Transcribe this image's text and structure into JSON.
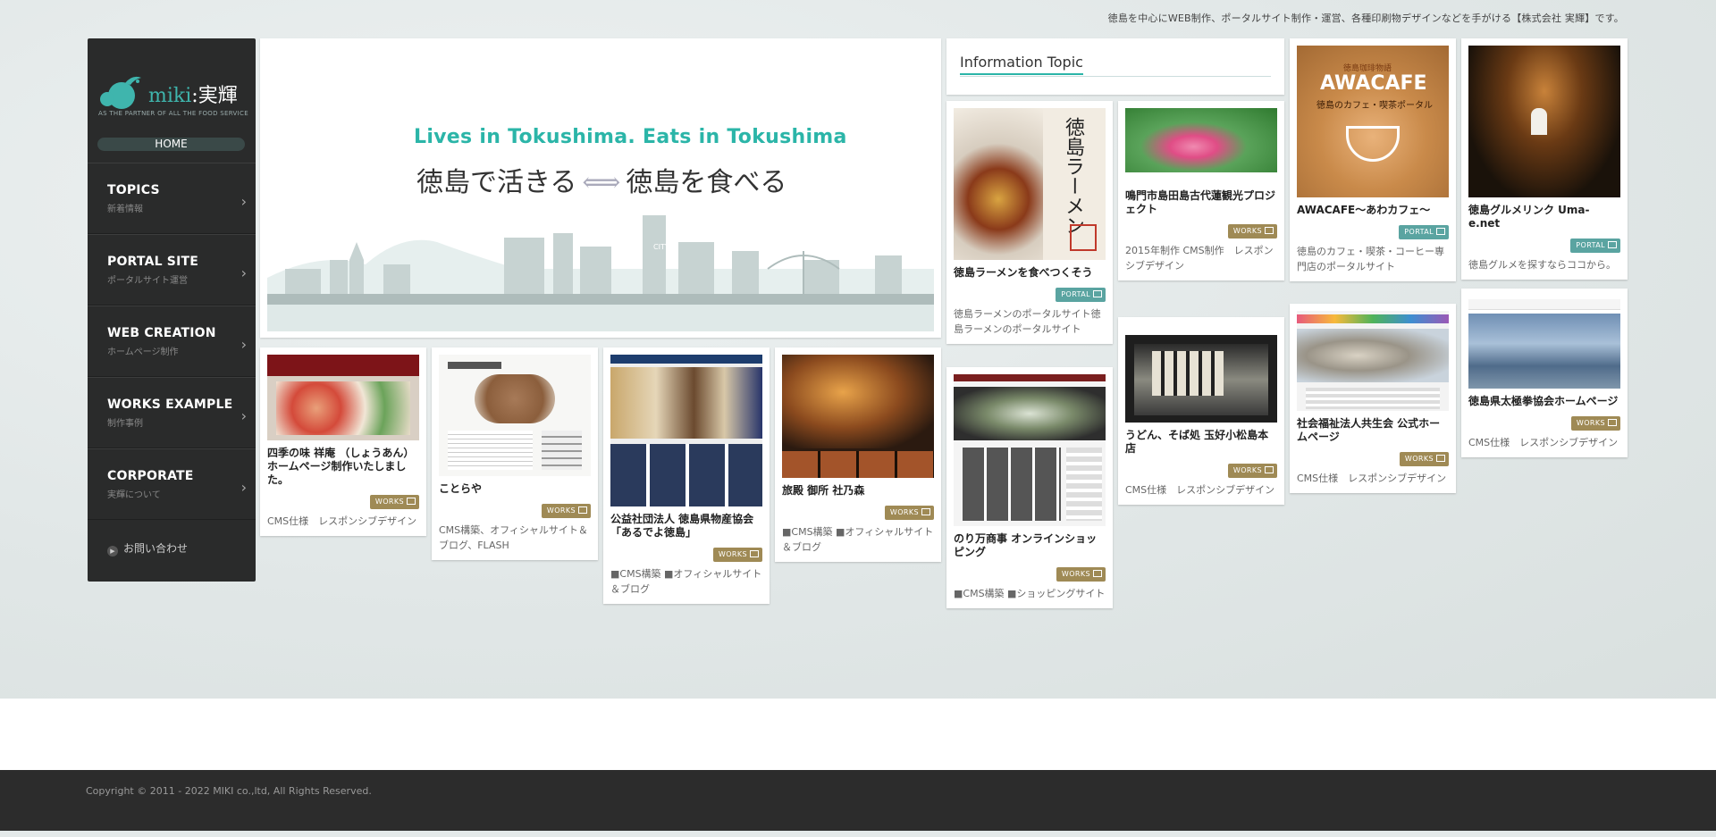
{
  "tagline": "徳島を中心にWEB制作、ポータルサイト制作・運営、各種印刷物デザインなどを手がける【株式会社 実輝】です。",
  "logo": {
    "brand_en": "miki",
    "brand_sep": ":",
    "brand_jp": "実輝",
    "sub": "AS THE PARTNER OF ALL THE FOOD SERVICE"
  },
  "sidebar": {
    "home": "HOME",
    "items": [
      {
        "title": "TOPICS",
        "sub": "新着情報"
      },
      {
        "title": "PORTAL SITE",
        "sub": "ポータルサイト運営"
      },
      {
        "title": "WEB CREATION",
        "sub": "ホームページ制作"
      },
      {
        "title": "WORKS EXAMPLE",
        "sub": "制作事例"
      },
      {
        "title": "CORPORATE",
        "sub": "実輝について"
      }
    ],
    "contact": "お問い合わせ"
  },
  "hero": {
    "en": "Lives in Tokushima. Eats in Tokushima",
    "jp_left": "徳島で活きる",
    "jp_arrow": "⟺",
    "jp_right": "徳島を食べる",
    "city_sign": "CITY"
  },
  "info": {
    "title": "Information Topic"
  },
  "badges": {
    "works": "WORKS",
    "portal": "PORTAL"
  },
  "cards": [
    {
      "title": "四季の味 祥庵 （しょうあん）ホームページ制作いたしました。",
      "badge": "WORKS",
      "desc": "CMS仕様　レスポンシブデザイン"
    },
    {
      "title": "ことらや",
      "badge": "WORKS",
      "desc": "CMS構築、オフィシャルサイト＆ブログ、FLASH"
    },
    {
      "title": "公益社団法人 徳島県物産協会「あるでよ徳島」",
      "badge": "WORKS",
      "desc": "■CMS構築 ■オフィシャルサイト＆ブログ"
    },
    {
      "title": "旅殿 御所 社乃森",
      "badge": "WORKS",
      "desc": "■CMS構築 ■オフィシャルサイト＆ブログ"
    },
    {
      "title": "徳島ラーメンを食べつくそう",
      "badge": "PORTAL",
      "desc": "徳島ラーメンのポータルサイト徳島ラーメンのポータルサイト",
      "thumb_text": "徳島ラーメン"
    },
    {
      "title": "のり万商事 オンラインショッピング",
      "badge": "WORKS",
      "desc": "■CMS構築 ■ショッピングサイト"
    },
    {
      "title": "鳴門市島田島古代蓮観光プロジェクト",
      "badge": "WORKS",
      "desc": "2015年制作 CMS制作　レスポンシブデザイン"
    },
    {
      "title": "うどん、そば処 玉好小松島本店",
      "badge": "WORKS",
      "desc": "CMS仕様　レスポンシブデザイン"
    },
    {
      "title": "AWACAFE〜あわカフェ〜",
      "badge": "PORTAL",
      "desc": "徳島のカフェ・喫茶・コーヒー専門店のポータルサイト",
      "thumb_top": "徳島珈琲物語",
      "thumb_logo": "AWACAFE",
      "thumb_sub": "徳島のカフェ・喫茶ポータル"
    },
    {
      "title": "社会福祉法人共生会 公式ホームページ",
      "badge": "WORKS",
      "desc": "CMS仕様　レスポンシブデザイン"
    },
    {
      "title": "徳島グルメリンク Uma-e.net",
      "badge": "PORTAL",
      "desc": "徳島グルメを探すならココから。"
    },
    {
      "title": "徳島県太極拳協会ホームページ",
      "badge": "WORKS",
      "desc": "CMS仕様　レスポンシブデザイン"
    }
  ],
  "footer": {
    "copyright": "Copyright © 2011 - 2022 MIKI co.,ltd, All Rights Reserved."
  }
}
